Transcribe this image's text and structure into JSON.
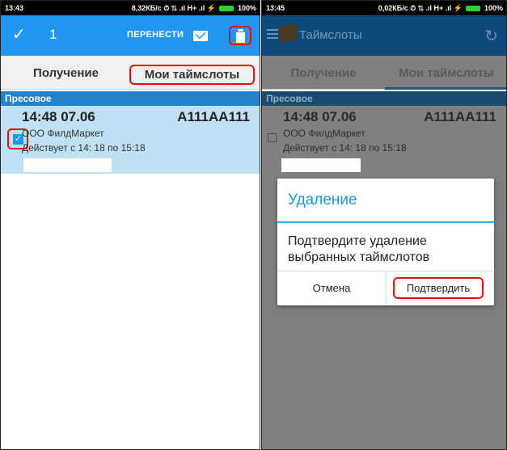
{
  "left_screen": {
    "status": {
      "time": "13:43",
      "info": "8,32КБ/с ⏱ ⇅ .ıl H+ .ıl ⚡",
      "battery": "100%"
    },
    "toolbar": {
      "check_icon": "✓",
      "count": "1",
      "move_label": "ПЕРЕНЕСТИ"
    },
    "tabs": {
      "receive": "Получение",
      "mine": "Мои таймслоты"
    },
    "section": "Пресовое",
    "card": {
      "time": "14:48 07.06",
      "plate": "А111АА111",
      "company": "ООО ФилдМаркет",
      "valid": "Действует с 14: 18 по 15:18",
      "checked": true,
      "check_mark": "✓"
    }
  },
  "right_screen": {
    "status": {
      "time": "13:45",
      "info": "0,02КБ/с ⏱ ⇅ .ıl H+ .ıl ⚡",
      "battery": "100%"
    },
    "toolbar": {
      "title": "Таймслоты",
      "refresh_icon": "↻"
    },
    "tabs": {
      "receive": "Получение",
      "mine": "Мои таймслоты"
    },
    "section": "Пресовое",
    "card": {
      "time": "14:48 07.06",
      "plate": "А111АА111",
      "company": "ООО ФилдМаркет",
      "valid": "Действует с 14: 18 по 15:18",
      "checked": false
    },
    "dialog": {
      "title": "Удаление",
      "message": "Подтвердите удаление выбранных таймслотов",
      "cancel": "Отмена",
      "confirm": "Подтвердить"
    }
  },
  "colors": {
    "accent": "#2196f3",
    "highlight": "#e01010",
    "card": "#bfe1f3",
    "section": "#2182cf",
    "dialog_title": "#1d96d8"
  },
  "icons": {
    "trash": "trash-icon",
    "mail": "mail-icon",
    "menu": "menu-icon",
    "truck": "truck-icon",
    "refresh": "refresh-icon",
    "check": "check-icon"
  }
}
